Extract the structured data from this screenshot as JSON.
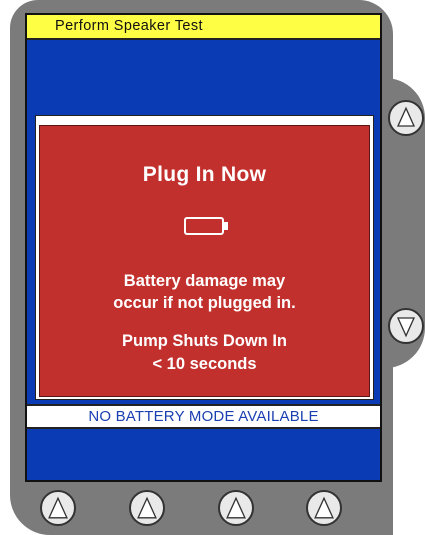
{
  "screen": {
    "title": "Perform Speaker Test",
    "alert": {
      "heading": "Plug In Now",
      "message_line1": "Battery damage may",
      "message_line2": "occur if not plugged in.",
      "countdown_line1": "Pump Shuts Down In",
      "countdown_line2": "< 10 seconds",
      "icon": "battery-empty-icon"
    },
    "footer": "NO BATTERY MODE AVAILABLE"
  },
  "colors": {
    "casing": "#7b7b7b",
    "screen_bg": "#0a3bb5",
    "title_bar": "#fefe45",
    "alert_bg": "#c2302e",
    "footer_text": "#1a3fb0"
  },
  "hardware_buttons": {
    "side": [
      "scroll-up",
      "scroll-down"
    ],
    "soft_keys": [
      "softkey-1",
      "softkey-2",
      "softkey-3",
      "softkey-4"
    ]
  }
}
